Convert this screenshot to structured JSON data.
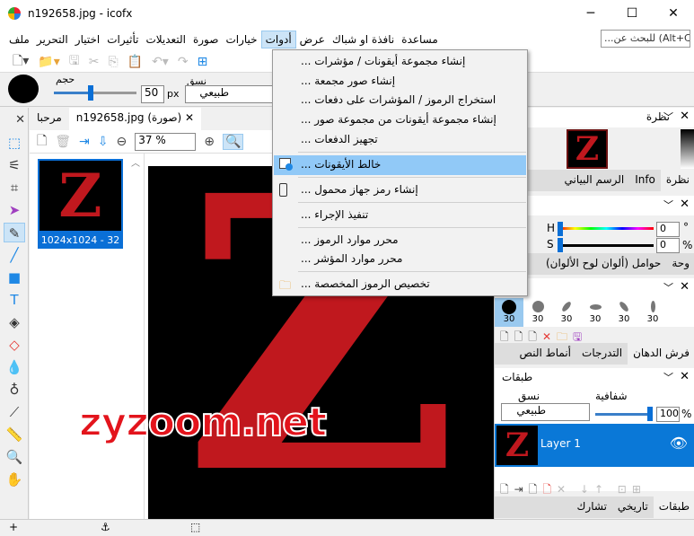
{
  "window": {
    "title": "n192658.jpg - icofx",
    "minimize": "─",
    "maximize": "☐",
    "close": "✕"
  },
  "menubar": {
    "items": [
      "ملف",
      "التحرير",
      "اختيار",
      "تأثيرات",
      "التعديلات",
      "صورة",
      "خيارات",
      "أدوات",
      "عرض",
      "نافذة او شباك",
      "مساعدة"
    ],
    "active_index": 7,
    "search_placeholder": "...للبحث عن (Alt+C"
  },
  "tool_options": {
    "size_label": "حجم",
    "size_value": "50",
    "size_unit": "px",
    "blend_label": "نسق",
    "blend_value": "طبيعي",
    "size_slider_percent": 45
  },
  "doc_tabs": {
    "welcome": "مرحبا",
    "document": "n192658.jpg (صورة)",
    "close": "✕"
  },
  "doc_toolbar": {
    "zoom": "37 %"
  },
  "thumbnail": {
    "caption": "1024x1024 - 32"
  },
  "canvas": {
    "watermark": "zyzoom.net",
    "letter": "Z"
  },
  "tools_menu": {
    "items": [
      {
        "label": "إنشاء مجموعة أيقونات / مؤشرات ..."
      },
      {
        "label": "إنشاء صور مجمعة ..."
      },
      {
        "label": "استخراج الرموز / المؤشرات على دفعات ..."
      },
      {
        "label": "إنشاء مجموعة أيقونات من مجموعة صور ..."
      },
      {
        "label": "تجهيز الدفعات ..."
      },
      {
        "label": "خالط الأيقونات ...",
        "highlighted": true,
        "icon": "icon-mixer-icon"
      },
      {
        "label": "إنشاء رمز جهاز محمول ...",
        "icon": "mobile-device-icon"
      },
      {
        "label": "تنفيذ الإجراء ..."
      },
      {
        "label": "محرر موارد الرموز ..."
      },
      {
        "label": "محرر موارد المؤشر ..."
      },
      {
        "label": "تخصيص الرموز المخصصة ...",
        "icon": "custom-folder-icon"
      }
    ]
  },
  "navigator_panel": {
    "title": "نظرة",
    "tabs": [
      "الرسم البياني",
      "Info",
      "نظرة"
    ]
  },
  "color_panel": {
    "h_label": "H",
    "h_value": "0",
    "h_unit": "°",
    "s_label": "S",
    "s_value": "0",
    "s_unit": "%",
    "tabs": [
      "وحة",
      "حوامل (ألوان لوح الألوان)"
    ]
  },
  "brushes_panel": {
    "title": "فرش الدهان",
    "sizes": [
      "30",
      "30",
      "30",
      "30",
      "30",
      "30"
    ],
    "tabs": [
      "أنماط النص",
      "التدرجات",
      "فرش الدهان"
    ]
  },
  "layers_panel": {
    "title": "طبقات",
    "blend_label": "نسق",
    "blend_value": "طبيعي",
    "opacity_label": "شفافية",
    "opacity_value": "100",
    "opacity_unit": "%",
    "layer_name": "Layer 1",
    "tabs": [
      "تشارك",
      "تاريخي",
      "طبقات"
    ]
  },
  "colors": {
    "accent": "#0a6fd6",
    "menu_highlight": "#91c9f7",
    "z_red": "#c0181e"
  }
}
